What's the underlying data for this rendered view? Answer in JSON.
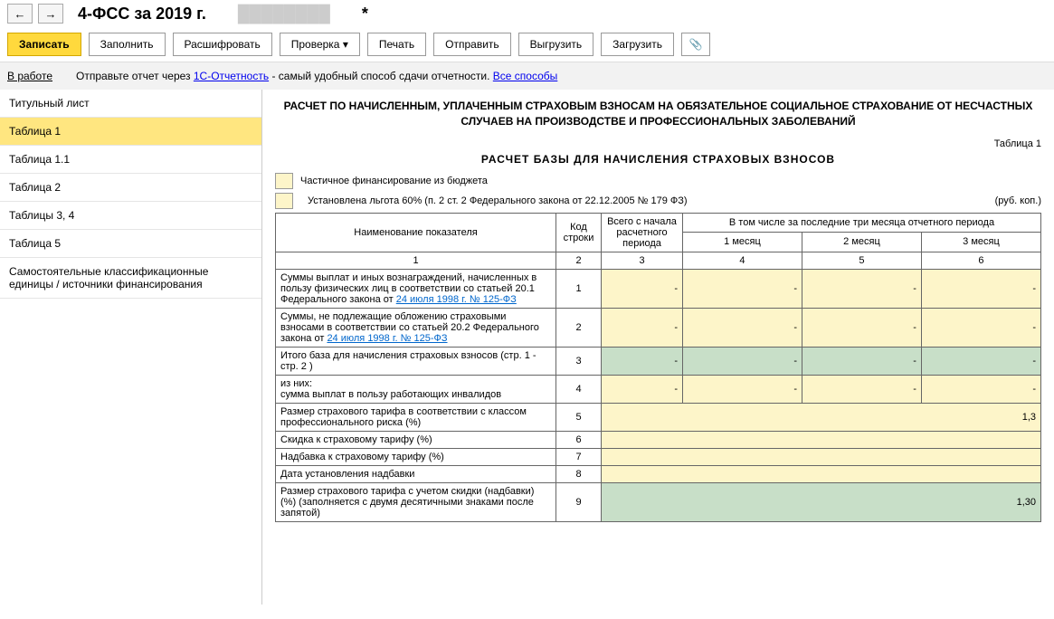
{
  "header": {
    "title": "4-ФСС за 2019 г.",
    "title_suffix": "*"
  },
  "toolbar": {
    "save": "Записать",
    "fill": "Заполнить",
    "decrypt": "Расшифровать",
    "check": "Проверка ▾",
    "print": "Печать",
    "send": "Отправить",
    "export": "Выгрузить",
    "import": "Загрузить"
  },
  "status": {
    "state": "В работе",
    "text_before": "Отправьте отчет через ",
    "link1": "1С-Отчетность",
    "text_after": " - самый удобный способ сдачи отчетности. ",
    "link2": "Все способы"
  },
  "sidebar": {
    "items": [
      "Титульный лист",
      "Таблица 1",
      "Таблица 1.1",
      "Таблица 2",
      "Таблицы 3, 4",
      "Таблица 5",
      "Самостоятельные классификационные единицы / источники финансирования"
    ]
  },
  "report": {
    "main_title": "РАСЧЕТ ПО НАЧИСЛЕННЫМ, УПЛАЧЕННЫМ СТРАХОВЫМ ВЗНОСАМ НА ОБЯЗАТЕЛЬНОЕ СОЦИАЛЬНОЕ СТРАХОВАНИЕ ОТ НЕСЧАСТНЫХ СЛУЧАЕВ НА ПРОИЗВОДСТВЕ И ПРОФЕССИОНАЛЬНЫХ ЗАБОЛЕВАНИЙ",
    "table_label": "Таблица 1",
    "subtitle": "РАСЧЕТ  БАЗЫ  ДЛЯ  НАЧИСЛЕНИЯ  СТРАХОВЫХ  ВЗНОСОВ",
    "check1": "Частичное финансирование из бюджета",
    "check2": "Установлена льгота 60% (п. 2 ст. 2 Федерального закона от 22.12.2005 № 179 ФЗ)",
    "unit": "(руб. коп.)",
    "headers": {
      "name": "Наименование показателя",
      "code": "Код строки",
      "total": "Всего с начала расчетного периода",
      "last3": "В том числе за последние три месяца отчетного периода",
      "m1": "1 месяц",
      "m2": "2 месяц",
      "m3": "3 месяц"
    },
    "colnums": [
      "1",
      "2",
      "3",
      "4",
      "5",
      "6"
    ],
    "rows": [
      {
        "name_pre": "Суммы выплат и иных вознаграждений, начисленных в пользу физических лиц в соответствии со статьей 20.1 Федерального закона от ",
        "link": "24 июля 1998 г. № 125-ФЗ",
        "code": "1",
        "type": "yellow"
      },
      {
        "name_pre": "Суммы, не подлежащие обложению страховыми взносами в соответствии со статьей 20.2 Федерального закона от ",
        "link": "24 июля 1998 г. № 125-ФЗ",
        "code": "2",
        "type": "yellow"
      },
      {
        "name": "Итого база для начисления страховых взносов (стр. 1 - стр. 2 )",
        "code": "3",
        "type": "green"
      },
      {
        "name": "из них:\nсумма выплат в пользу работающих инвалидов",
        "code": "4",
        "type": "yellow"
      },
      {
        "name": "Размер страхового тарифа в соответствии с классом профессионального риска (%)",
        "code": "5",
        "type": "wide_yellow",
        "value": "1,3"
      },
      {
        "name": "Скидка к страховому тарифу (%)",
        "code": "6",
        "type": "wide_yellow"
      },
      {
        "name": "Надбавка к страховому тарифу (%)",
        "code": "7",
        "type": "wide_yellow"
      },
      {
        "name": "Дата установления надбавки",
        "code": "8",
        "type": "wide_yellow"
      },
      {
        "name": "Размер страхового тарифа с учетом скидки (надбавки) (%) (заполняется с двумя десятичными знаками после запятой)",
        "code": "9",
        "type": "wide_green",
        "value": "1,30"
      }
    ]
  }
}
